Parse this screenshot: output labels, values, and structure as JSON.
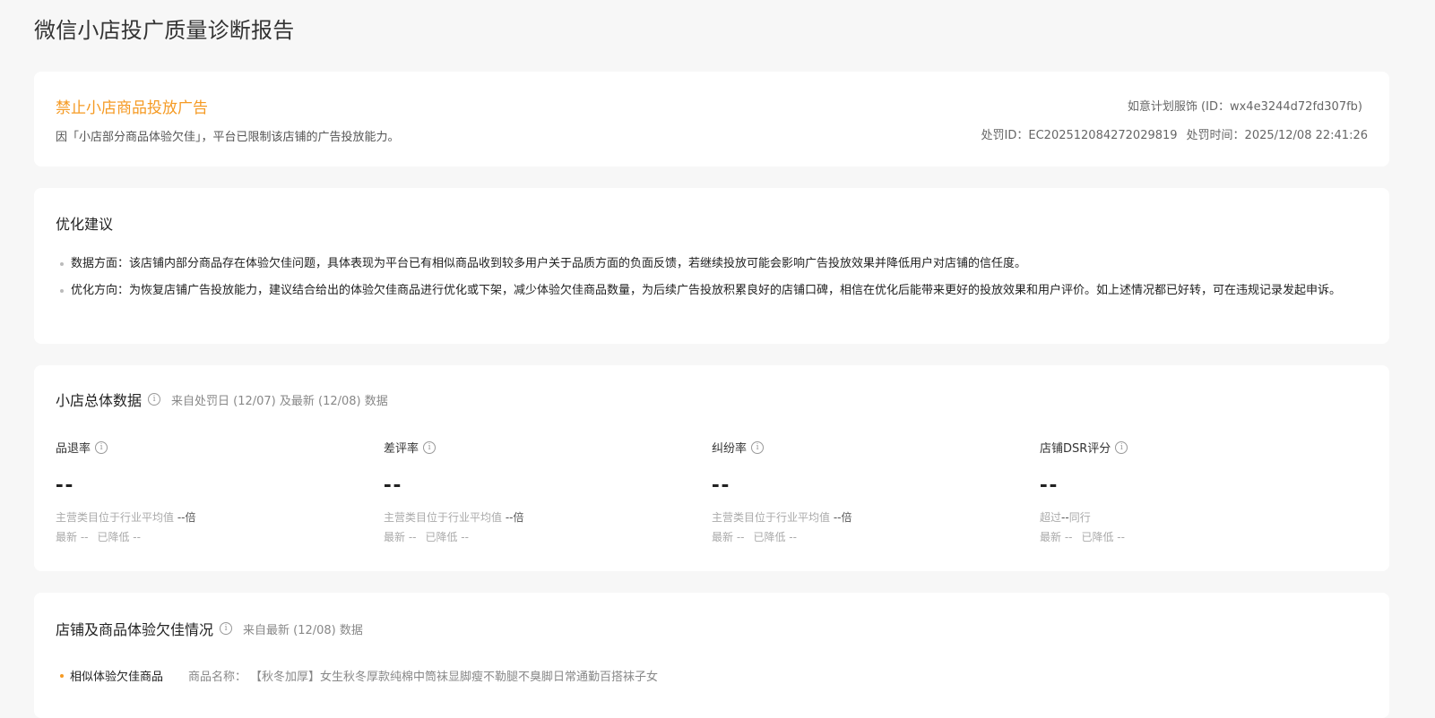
{
  "page": {
    "title": "微信小店投广质量诊断报告"
  },
  "penalty": {
    "title": "禁止小店商品投放广告",
    "description": "因「小店部分商品体验欠佳」，平台已限制该店铺的广告投放能力。",
    "shop_info": "如意计划服饰 (ID：wx4e3244d72fd307fb)",
    "penalty_id": "处罚ID：EC202512084272029819",
    "penalty_time": "处罚时间：2025/12/08 22:41:26"
  },
  "suggestions": {
    "title": "优化建议",
    "items": [
      "数据方面：该店铺内部分商品存在体验欠佳问题，具体表现为平台已有相似商品收到较多用户关于品质方面的负面反馈，若继续投放可能会影响广告投放效果并降低用户对店铺的信任度。",
      "优化方向：为恢复店铺广告投放能力，建议结合给出的体验欠佳商品进行优化或下架，减少体验欠佳商品数量，为后续广告投放积累良好的店铺口碑，相信在优化后能带来更好的投放效果和用户评价。如上述情况都已好转，可在违规记录发起申诉。"
    ]
  },
  "overall": {
    "title": "小店总体数据",
    "note": "来自处罚日 (12/07) 及最新 (12/08) 数据",
    "metrics": [
      {
        "label": "品退率",
        "value": "--",
        "sub_prefix": "主营类目位于行业平均值 ",
        "sub_value": "--倍",
        "latest": "最新 --",
        "reduced": "已降低 --"
      },
      {
        "label": "差评率",
        "value": "--",
        "sub_prefix": "主营类目位于行业平均值 ",
        "sub_value": "--倍",
        "latest": "最新 --",
        "reduced": "已降低 --"
      },
      {
        "label": "纠纷率",
        "value": "--",
        "sub_prefix": "主营类目位于行业平均值 ",
        "sub_value": "--倍",
        "latest": "最新 --",
        "reduced": "已降低 --"
      },
      {
        "label": "店铺DSR评分",
        "value": "--",
        "sub_prefix": "超过",
        "sub_value": "--",
        "sub_suffix": "同行",
        "latest": "最新 --",
        "reduced": "已降低 --"
      }
    ]
  },
  "experience": {
    "title": "店铺及商品体验欠佳情况",
    "note": "来自最新 (12/08) 数据",
    "row_label": "相似体验欠佳商品",
    "product_label": "商品名称：",
    "product_name": "【秋冬加厚】女生秋冬厚款纯棉中筒袜显脚瘦不勒腿不臭脚日常通勤百搭袜子女"
  },
  "colors": {
    "accent": "#f59a23",
    "background": "#f7f7f7",
    "card": "#ffffff"
  },
  "icons": {
    "info": "info-circle-icon"
  }
}
